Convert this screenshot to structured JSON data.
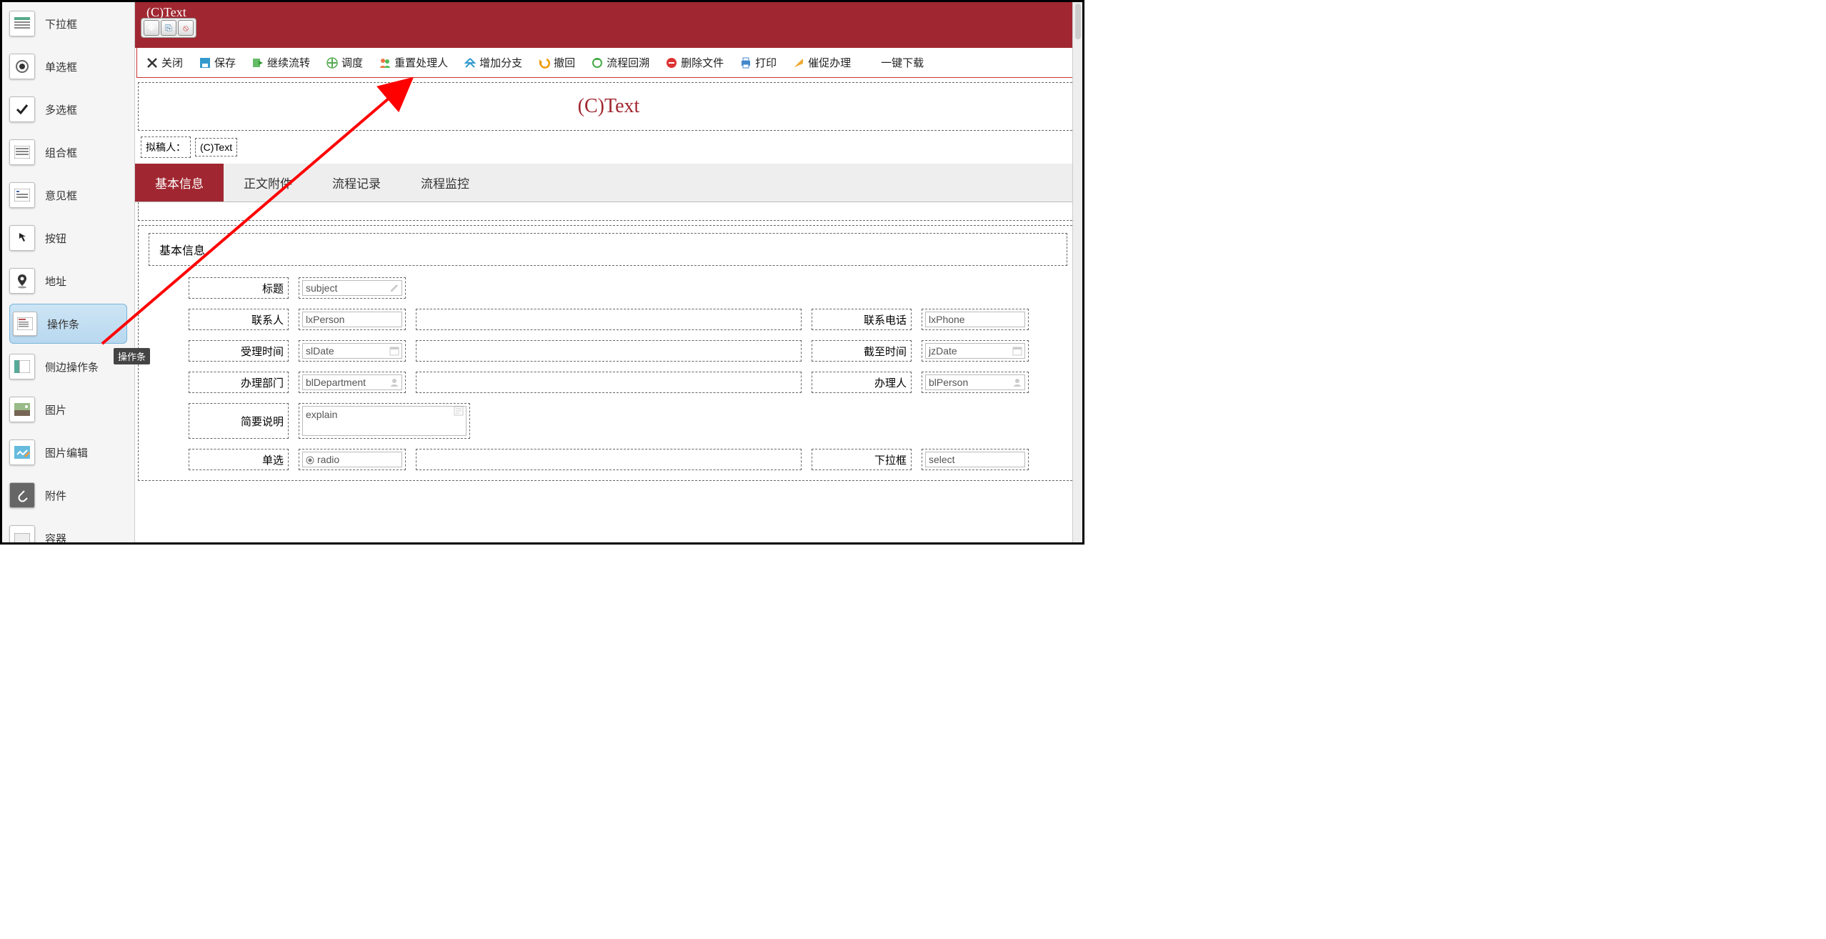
{
  "sidebar": {
    "items": [
      {
        "label": "下拉框",
        "icon": "dropdown-icon"
      },
      {
        "label": "单选框",
        "icon": "radio-icon"
      },
      {
        "label": "多选框",
        "icon": "checkbox-icon"
      },
      {
        "label": "组合框",
        "icon": "combo-icon"
      },
      {
        "label": "意见框",
        "icon": "opinion-icon"
      },
      {
        "label": "按钮",
        "icon": "button-icon"
      },
      {
        "label": "地址",
        "icon": "address-icon"
      },
      {
        "label": "操作条",
        "icon": "actionbar-icon"
      },
      {
        "label": "侧边操作条",
        "icon": "side-actionbar-icon"
      },
      {
        "label": "图片",
        "icon": "image-icon"
      },
      {
        "label": "图片编辑",
        "icon": "image-edit-icon"
      },
      {
        "label": "附件",
        "icon": "attachment-icon"
      },
      {
        "label": "容器",
        "icon": "container-icon"
      }
    ],
    "tooltip": "操作条"
  },
  "redbar": {
    "partial_text": "(C)Text"
  },
  "redbar_tools": {
    "move": "✥",
    "copy": "⎘",
    "del": "⦸"
  },
  "toolbar": [
    {
      "label": "关闭",
      "name": "close"
    },
    {
      "label": "保存",
      "name": "save"
    },
    {
      "label": "继续流转",
      "name": "continue"
    },
    {
      "label": "调度",
      "name": "dispatch"
    },
    {
      "label": "重置处理人",
      "name": "reset-handler"
    },
    {
      "label": "增加分支",
      "name": "add-branch"
    },
    {
      "label": "撤回",
      "name": "recall"
    },
    {
      "label": "流程回溯",
      "name": "retrace"
    },
    {
      "label": "删除文件",
      "name": "delete-file"
    },
    {
      "label": "打印",
      "name": "print"
    },
    {
      "label": "催促办理",
      "name": "urge"
    },
    {
      "label": "一键下载",
      "name": "download-all"
    }
  ],
  "title_text": "(C)Text",
  "author": {
    "label": "拟稿人：",
    "value": "(C)Text"
  },
  "tabs": [
    {
      "label": "基本信息",
      "active": true
    },
    {
      "label": "正文附件",
      "active": false
    },
    {
      "label": "流程记录",
      "active": false
    },
    {
      "label": "流程监控",
      "active": false
    }
  ],
  "fieldset_title": "基本信息",
  "form": {
    "subject_label": "标题",
    "subject": "subject",
    "lxPerson_label": "联系人",
    "lxPerson": "lxPerson",
    "lxPhone_label": "联系电话",
    "lxPhone": "lxPhone",
    "slDate_label": "受理时间",
    "slDate": "slDate",
    "jzDate_label": "截至时间",
    "jzDate": "jzDate",
    "blDepartment_label": "办理部门",
    "blDepartment": "blDepartment",
    "blPerson_label": "办理人",
    "blPerson": "blPerson",
    "explain_label": "简要说明",
    "explain": "explain",
    "radio_label": "单选",
    "radio": "radio",
    "select_label": "下拉框",
    "select": "select"
  }
}
